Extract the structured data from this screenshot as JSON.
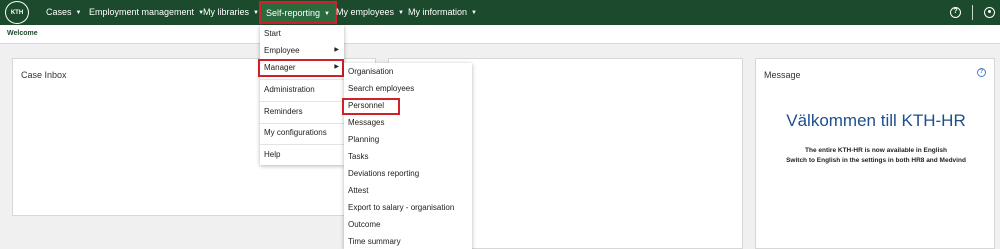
{
  "nav": {
    "logo_text": "KTH",
    "items": [
      {
        "label": "Cases"
      },
      {
        "label": "Employment management"
      },
      {
        "label": "My libraries"
      },
      {
        "label": "Self-reporting"
      },
      {
        "label": "My employees"
      },
      {
        "label": "My information"
      }
    ],
    "caret": "▼",
    "help_icon": "?"
  },
  "breadcrumb": "Welcome",
  "case_inbox": {
    "title": "Case Inbox"
  },
  "message": {
    "title": "Message",
    "help_icon": "?",
    "heading": "Välkommen till KTH-HR",
    "line1": "The entire KTH-HR is now available in English",
    "line2": "Switch to English in the settings in both HR8 and Medvind"
  },
  "self_reporting_menu": {
    "items": [
      {
        "label": "Start"
      },
      {
        "label": "Employee"
      },
      {
        "label": "Manager"
      },
      {
        "label": "Administration"
      },
      {
        "label": "Reminders"
      },
      {
        "label": "My configurations"
      },
      {
        "label": "Help"
      }
    ],
    "submenu_arrow": "▶"
  },
  "manager_menu": {
    "items": [
      {
        "label": "Organisation"
      },
      {
        "label": "Search employees"
      },
      {
        "label": "Personnel"
      },
      {
        "label": "Messages"
      },
      {
        "label": "Planning"
      },
      {
        "label": "Tasks"
      },
      {
        "label": "Deviations reporting"
      },
      {
        "label": "Attest"
      },
      {
        "label": "Export to salary - organisation"
      },
      {
        "label": "Outcome"
      },
      {
        "label": "Time summary"
      }
    ]
  },
  "colors": {
    "nav_bg": "#1c4a2c",
    "highlight": "#d0202a",
    "heading_blue": "#1e4f8c"
  }
}
